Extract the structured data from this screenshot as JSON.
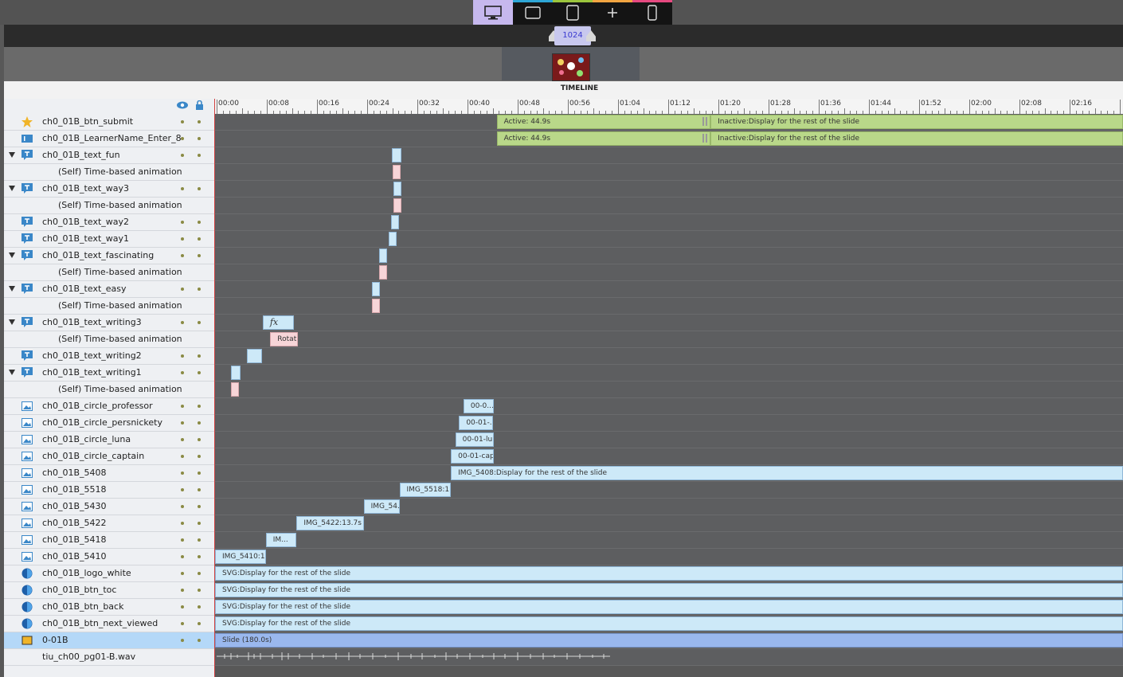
{
  "devices": [
    {
      "name": "desktop-icon",
      "active": true,
      "color": "#c6b8ee"
    },
    {
      "name": "tablet-landscape-icon",
      "active": false,
      "color": "#2ea6d6"
    },
    {
      "name": "tablet-portrait-icon",
      "active": false,
      "color": "#9bc53d"
    },
    {
      "name": "add-icon",
      "active": false,
      "color": "#f2a541"
    },
    {
      "name": "phone-icon",
      "active": false,
      "color": "#e64980"
    }
  ],
  "breakpoint": "1024",
  "timeline_title": "TIMELINE",
  "time_labels": [
    "00:00",
    "00:08",
    "00:16",
    "00:24",
    "00:32",
    "00:40",
    "00:48",
    "00:56",
    "01:04",
    "01:12",
    "01:20",
    "01:28",
    "01:36",
    "01:44",
    "01:52",
    "02:00",
    "02:08",
    "02:16"
  ],
  "rows": [
    {
      "label": "ch0_01B_btn_submit",
      "icon": "star-icon",
      "expand": false,
      "sub": false,
      "blocks": [
        {
          "s": 44.9,
          "e": 79,
          "cls": "green",
          "text": "Active: 44.9s"
        },
        {
          "s": 79,
          "e": 200,
          "cls": "green",
          "text": "Inactive:Display for the rest of the slide"
        }
      ]
    },
    {
      "label": "ch0_01B_LearnerName_Enter_8",
      "icon": "text-entry-icon",
      "expand": false,
      "sub": false,
      "blocks": [
        {
          "s": 44.9,
          "e": 79,
          "cls": "green",
          "text": "Active: 44.9s"
        },
        {
          "s": 79,
          "e": 200,
          "cls": "green",
          "text": "Inactive:Display for the rest of the slide"
        }
      ]
    },
    {
      "label": "ch0_01B_text_fun",
      "icon": "text-caption-icon",
      "expand": true,
      "sub": false,
      "blocks": [
        {
          "s": 28.2,
          "e": 29.7,
          "cls": "blue",
          "text": ""
        }
      ]
    },
    {
      "label": "(Self) Time-based animation",
      "icon": "",
      "expand": false,
      "sub": true,
      "blocks": [
        {
          "s": 28.3,
          "e": 29.0,
          "cls": "pink",
          "text": ""
        }
      ]
    },
    {
      "label": "ch0_01B_text_way3",
      "icon": "text-caption-icon",
      "expand": true,
      "sub": false,
      "blocks": [
        {
          "s": 28.4,
          "e": 28.8,
          "cls": "blue",
          "text": ""
        }
      ]
    },
    {
      "label": "(Self) Time-based animation",
      "icon": "",
      "expand": false,
      "sub": true,
      "blocks": [
        {
          "s": 28.4,
          "e": 28.8,
          "cls": "pink",
          "text": ""
        }
      ]
    },
    {
      "label": "ch0_01B_text_way2",
      "icon": "text-caption-icon",
      "expand": false,
      "sub": false,
      "blocks": [
        {
          "s": 28.0,
          "e": 28.2,
          "cls": "blue",
          "text": ""
        }
      ]
    },
    {
      "label": "ch0_01B_text_way1",
      "icon": "text-caption-icon",
      "expand": false,
      "sub": false,
      "blocks": [
        {
          "s": 27.7,
          "e": 27.9,
          "cls": "blue",
          "text": ""
        }
      ]
    },
    {
      "label": "ch0_01B_text_fascinating",
      "icon": "text-caption-icon",
      "expand": true,
      "sub": false,
      "blocks": [
        {
          "s": 26.2,
          "e": 27.0,
          "cls": "blue",
          "text": ""
        }
      ]
    },
    {
      "label": "(Self) Time-based animation",
      "icon": "",
      "expand": false,
      "sub": true,
      "blocks": [
        {
          "s": 26.2,
          "e": 27.0,
          "cls": "pink",
          "text": ""
        }
      ]
    },
    {
      "label": "ch0_01B_text_easy",
      "icon": "text-caption-icon",
      "expand": true,
      "sub": false,
      "blocks": [
        {
          "s": 25.0,
          "e": 25.8,
          "cls": "blue",
          "text": ""
        }
      ]
    },
    {
      "label": "(Self) Time-based animation",
      "icon": "",
      "expand": false,
      "sub": true,
      "blocks": [
        {
          "s": 25.0,
          "e": 25.8,
          "cls": "pink",
          "text": ""
        }
      ]
    },
    {
      "label": "ch0_01B_text_writing3",
      "icon": "text-caption-icon",
      "expand": true,
      "sub": false,
      "blocks": [
        {
          "s": 7.6,
          "e": 12.6,
          "cls": "blue",
          "text": "fx",
          "fx": true
        }
      ]
    },
    {
      "label": "(Self) Time-based animation",
      "icon": "",
      "expand": false,
      "sub": true,
      "blocks": [
        {
          "s": 8.8,
          "e": 13.2,
          "cls": "pink",
          "text": "Rotat..."
        }
      ]
    },
    {
      "label": "ch0_01B_text_writing2",
      "icon": "text-caption-icon",
      "expand": false,
      "sub": false,
      "blocks": [
        {
          "s": 5.1,
          "e": 7.5,
          "cls": "blue",
          "text": ""
        }
      ]
    },
    {
      "label": "ch0_01B_text_writing1",
      "icon": "text-caption-icon",
      "expand": true,
      "sub": false,
      "blocks": [
        {
          "s": 2.5,
          "e": 4.0,
          "cls": "blue",
          "text": ""
        }
      ]
    },
    {
      "label": "(Self) Time-based animation",
      "icon": "",
      "expand": false,
      "sub": true,
      "blocks": [
        {
          "s": 2.5,
          "e": 3.2,
          "cls": "pink",
          "text": ""
        }
      ]
    },
    {
      "label": "ch0_01B_circle_professor",
      "icon": "image-icon",
      "expand": false,
      "sub": false,
      "blocks": [
        {
          "s": 39.6,
          "e": 44.4,
          "cls": "blue",
          "text": "00-0..."
        }
      ]
    },
    {
      "label": "ch0_01B_circle_persnickety",
      "icon": "image-icon",
      "expand": false,
      "sub": false,
      "blocks": [
        {
          "s": 38.9,
          "e": 44.3,
          "cls": "blue",
          "text": "00-01-..."
        }
      ]
    },
    {
      "label": "ch0_01B_circle_luna",
      "icon": "image-icon",
      "expand": false,
      "sub": false,
      "blocks": [
        {
          "s": 38.3,
          "e": 44.5,
          "cls": "blue",
          "text": "00-01-lu..."
        }
      ]
    },
    {
      "label": "ch0_01B_circle_captain",
      "icon": "image-icon",
      "expand": false,
      "sub": false,
      "blocks": [
        {
          "s": 37.6,
          "e": 44.5,
          "cls": "blue",
          "text": "00-01-cap..."
        }
      ]
    },
    {
      "label": "ch0_01B_5408",
      "icon": "image-icon",
      "expand": false,
      "sub": false,
      "blocks": [
        {
          "s": 37.6,
          "e": 200,
          "cls": "blue",
          "text": "IMG_5408:Display for the rest of the slide"
        }
      ]
    },
    {
      "label": "ch0_01B_5518",
      "icon": "image-icon",
      "expand": false,
      "sub": false,
      "blocks": [
        {
          "s": 29.4,
          "e": 37.6,
          "cls": "blue",
          "text": "IMG_5518:1..."
        }
      ]
    },
    {
      "label": "ch0_01B_5430",
      "icon": "image-icon",
      "expand": false,
      "sub": false,
      "blocks": [
        {
          "s": 23.7,
          "e": 29.4,
          "cls": "blue",
          "text": "IMG_54..."
        }
      ]
    },
    {
      "label": "ch0_01B_5422",
      "icon": "image-icon",
      "expand": false,
      "sub": false,
      "blocks": [
        {
          "s": 13.0,
          "e": 23.7,
          "cls": "blue",
          "text": "IMG_5422:13.7s"
        }
      ]
    },
    {
      "label": "ch0_01B_5418",
      "icon": "image-icon",
      "expand": false,
      "sub": false,
      "blocks": [
        {
          "s": 8.1,
          "e": 13.0,
          "cls": "blue",
          "text": "IM..."
        }
      ]
    },
    {
      "label": "ch0_01B_5410",
      "icon": "image-icon",
      "expand": false,
      "sub": false,
      "blocks": [
        {
          "s": 0.0,
          "e": 8.1,
          "cls": "blue",
          "text": "IMG_5410:10..."
        }
      ]
    },
    {
      "label": "ch0_01B_logo_white",
      "icon": "svg-icon",
      "expand": false,
      "sub": false,
      "blocks": [
        {
          "s": 0.0,
          "e": 200,
          "cls": "blue",
          "text": "SVG:Display for the rest of the slide"
        }
      ]
    },
    {
      "label": "ch0_01B_btn_toc",
      "icon": "svg-icon",
      "expand": false,
      "sub": false,
      "blocks": [
        {
          "s": 0.0,
          "e": 200,
          "cls": "blue",
          "text": "SVG:Display for the rest of the slide"
        }
      ]
    },
    {
      "label": "ch0_01B_btn_back",
      "icon": "svg-icon",
      "expand": false,
      "sub": false,
      "blocks": [
        {
          "s": 0.0,
          "e": 200,
          "cls": "blue",
          "text": "SVG:Display for the rest of the slide"
        }
      ]
    },
    {
      "label": "ch0_01B_btn_next_viewed",
      "icon": "svg-icon",
      "expand": false,
      "sub": false,
      "blocks": [
        {
          "s": 0.0,
          "e": 200,
          "cls": "blue",
          "text": "SVG:Display for the rest of the slide"
        }
      ]
    },
    {
      "label": "0-01B",
      "icon": "slide-icon",
      "expand": false,
      "sub": false,
      "selected": true,
      "blocks": [
        {
          "s": 0.0,
          "e": 200,
          "cls": "slide",
          "text": "Slide (180.0s)"
        }
      ]
    },
    {
      "label": "tiu_ch00_pg01-B.wav",
      "icon": "",
      "expand": false,
      "sub": false,
      "audio": true,
      "blocks": []
    }
  ]
}
